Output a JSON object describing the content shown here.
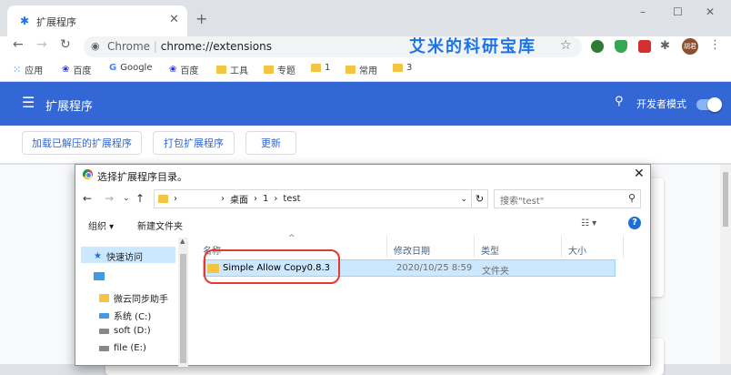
{
  "browser": {
    "tab_title": "扩展程序",
    "omnibox": {
      "site": "Chrome",
      "separator": "|",
      "url": "chrome://extensions"
    },
    "watermark": "艾米的科研宝库",
    "window_controls": {
      "minimize": "–",
      "maximize": "☐",
      "close": "✕"
    },
    "bookmarks": [
      {
        "label": "应用",
        "icon": "apps-grid-icon"
      },
      {
        "label": "百度",
        "icon": "baidu-paw-icon"
      },
      {
        "label": "Google",
        "icon": "google-g-icon"
      },
      {
        "label": "百度",
        "icon": "baidu-paw-icon"
      },
      {
        "label": "工具",
        "icon": "folder-icon"
      },
      {
        "label": "专题",
        "icon": "folder-icon"
      },
      {
        "label": "1",
        "icon": "folder-icon"
      },
      {
        "label": "常用",
        "icon": "folder-icon"
      },
      {
        "label": "3",
        "icon": "folder-icon"
      }
    ],
    "avatar_text": "胡君"
  },
  "extensions_page": {
    "title": "扩展程序",
    "dev_mode_label": "开发者模式",
    "dev_mode_on": true,
    "buttons": {
      "load_unpacked": "加载已解压的扩展程序",
      "pack": "打包扩展程序",
      "update": "更新"
    }
  },
  "dialog": {
    "title": "选择扩展程序目录。",
    "path": {
      "hidden": "›",
      "seg1": "桌面",
      "sep": "›",
      "seg2": "1",
      "seg3": "test"
    },
    "search_placeholder": "搜索\"test\"",
    "commands": {
      "organize": "组织 ▾",
      "new_folder": "新建文件夹"
    },
    "nav": {
      "quick_access": "快速访问",
      "items": [
        {
          "label": "微云同步助手"
        },
        {
          "label": "系统 (C:)"
        },
        {
          "label": "soft (D:)"
        },
        {
          "label": "file (E:)"
        }
      ]
    },
    "columns": {
      "name": "名称",
      "date": "修改日期",
      "type": "类型",
      "size": "大小"
    },
    "files": [
      {
        "name": "Simple Allow Copy0.8.3",
        "date": "2020/10/25 8:59",
        "type": "文件夹"
      }
    ]
  }
}
